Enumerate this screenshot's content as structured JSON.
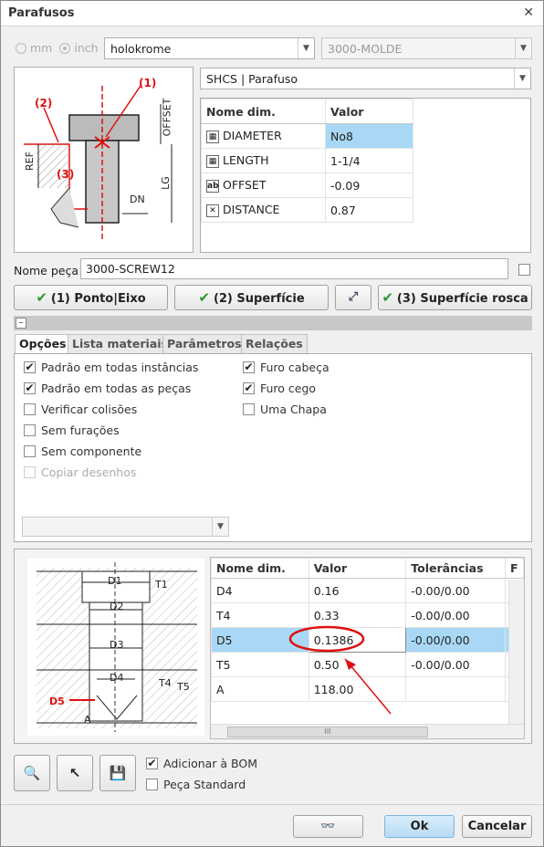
{
  "window": {
    "title": "Parafusos"
  },
  "units": {
    "mm": "mm",
    "inch": "inch",
    "selected": "inch"
  },
  "catalog": {
    "selected": "holokrome"
  },
  "mold": {
    "selected": "3000-MOLDE"
  },
  "type": {
    "selected": "SHCS | Parafuso"
  },
  "top_diagram": {
    "label1": "(1)",
    "label2": "(2)",
    "label3": "(3)",
    "ref": "REF",
    "offset": "OFFSET",
    "lg": "LG",
    "dn": "DN"
  },
  "dim_table": {
    "headers": [
      "Nome dim.",
      "Valor"
    ],
    "rows": [
      {
        "icon": "table-icon",
        "name": "DIAMETER",
        "value": "No8"
      },
      {
        "icon": "table-icon",
        "name": "LENGTH",
        "value": "1-1/4"
      },
      {
        "icon": "text-icon",
        "name": "OFFSET",
        "value": "-0.09"
      },
      {
        "icon": "cross-icon",
        "name": "DISTANCE",
        "value": "0.87"
      }
    ]
  },
  "part_name": {
    "label": "Nome peça",
    "value": "3000-SCREW12"
  },
  "refs": {
    "point": "(1) Ponto|Eixo",
    "surface": "(2) Superfície",
    "thread": "(3) Superfície rosca"
  },
  "tabs": [
    "Opções",
    "Lista materiais",
    "Parâmetros",
    "Relações"
  ],
  "options_left": [
    {
      "label": "Padrão em todas instâncias",
      "checked": true
    },
    {
      "label": "Padrão em todas as peças",
      "checked": true
    },
    {
      "label": "Verificar colisões",
      "checked": false
    },
    {
      "label": "Sem furações",
      "checked": false
    },
    {
      "label": "Sem componente",
      "checked": false
    },
    {
      "label": "Copiar desenhos",
      "checked": false
    }
  ],
  "options_right": [
    {
      "label": "Furo cabeça",
      "checked": true
    },
    {
      "label": "Furo cego",
      "checked": true
    },
    {
      "label": "Uma Chapa",
      "checked": false
    }
  ],
  "hole_diagram": {
    "d1": "D1",
    "d2": "D2",
    "d3": "D3",
    "d4": "D4",
    "t1": "T1",
    "t4": "T4",
    "t5": "T5",
    "d5": "D5",
    "a": "A"
  },
  "hole_table": {
    "headers": [
      "Nome dim.",
      "Valor",
      "Tolerâncias",
      "F"
    ],
    "rows": [
      {
        "name": "D4",
        "value": "0.16",
        "tol": "-0.00/0.00"
      },
      {
        "name": "T4",
        "value": "0.33",
        "tol": "-0.00/0.00"
      },
      {
        "name": "D5",
        "value": "0.1386",
        "tol": "-0.00/0.00"
      },
      {
        "name": "T5",
        "value": "0.50",
        "tol": "-0.00/0.00"
      },
      {
        "name": "A",
        "value": "118.00",
        "tol": ""
      }
    ],
    "scroll_grip": "III"
  },
  "bom": {
    "add": "Adicionar à BOM",
    "standard": "Peça Standard"
  },
  "footer": {
    "ok": "Ok",
    "cancel": "Cancelar"
  },
  "colors": {
    "accent": "#a8d8f5",
    "ok_button": "#c5e2f7",
    "annotation": "#e01010"
  }
}
